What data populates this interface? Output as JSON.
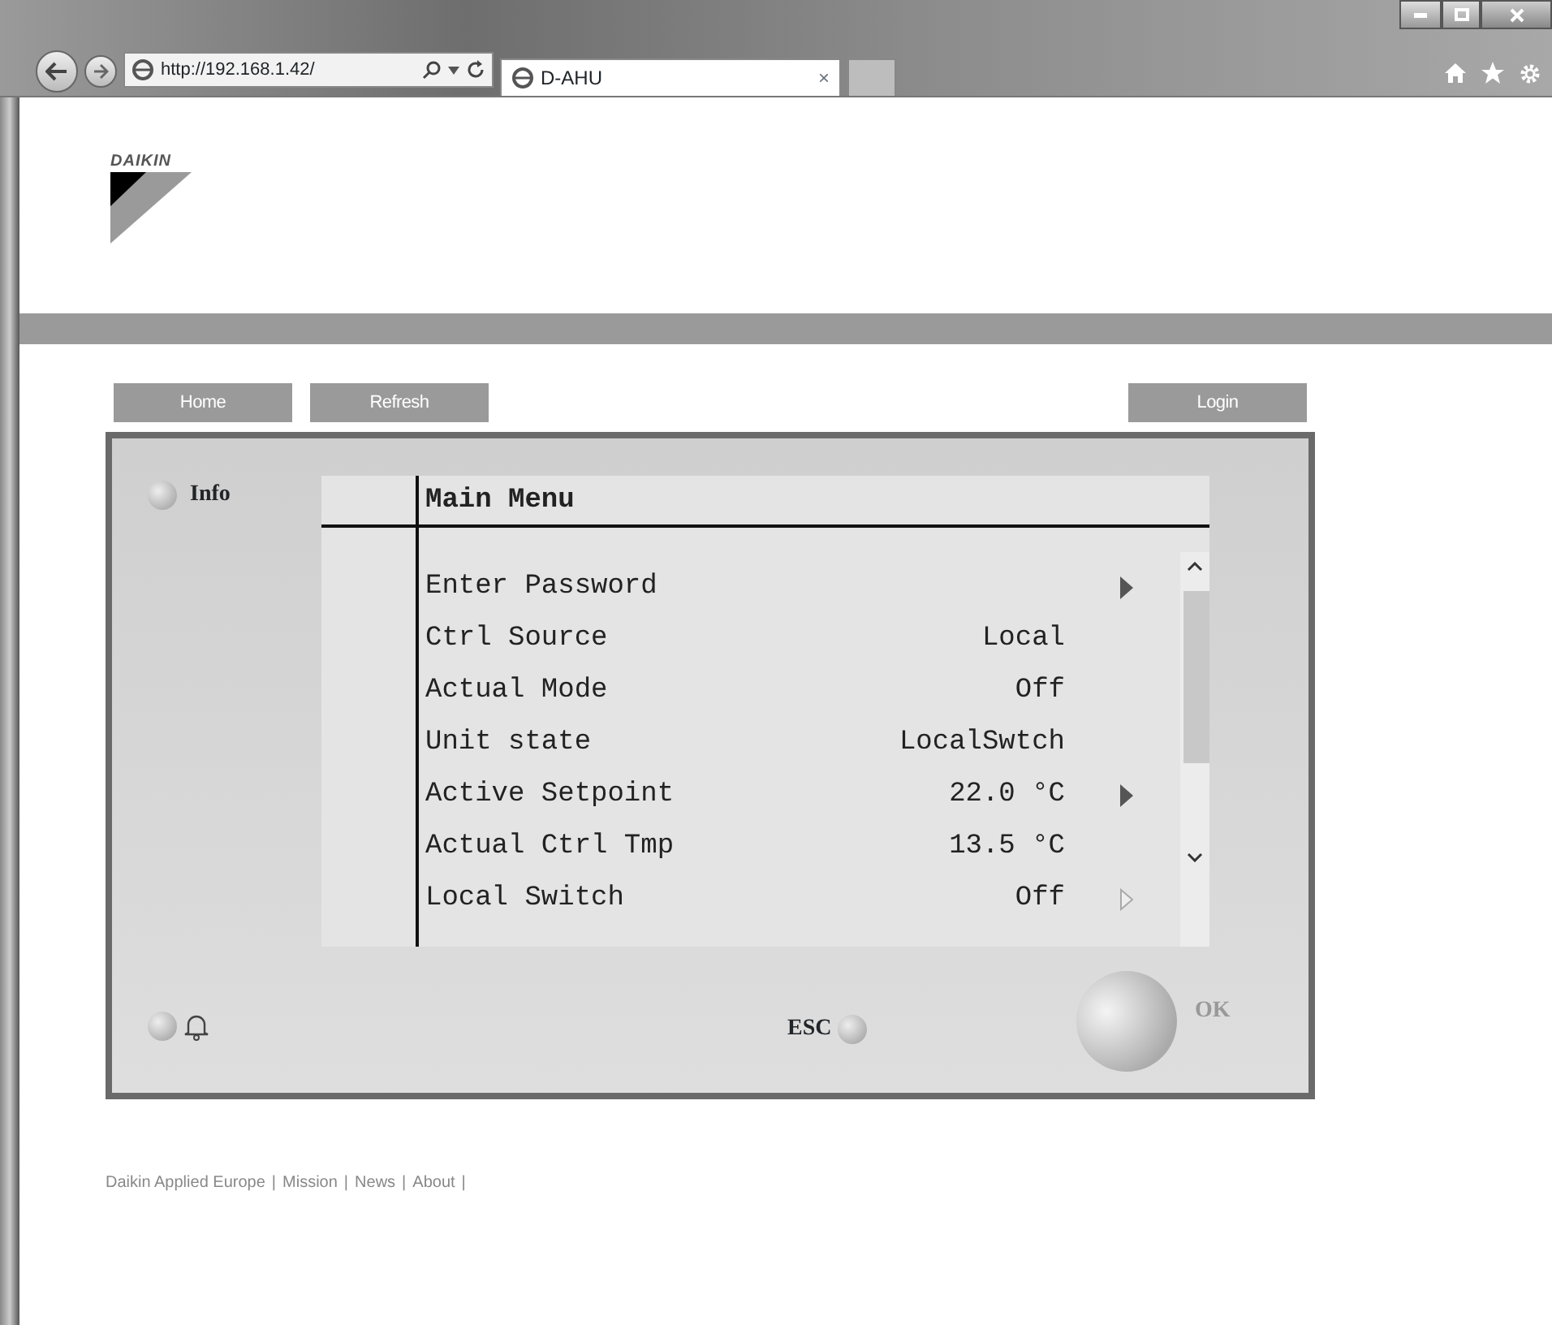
{
  "browser": {
    "address": "http://192.168.1.42/",
    "tab_title": "D-AHU",
    "tab_close": "×"
  },
  "logo": {
    "text": "DAIKIN"
  },
  "nav_buttons": [
    "Home",
    "Refresh"
  ],
  "login_button": "Login",
  "panel": {
    "info_label": "Info",
    "esc_label": "ESC",
    "ok_label": "OK",
    "screen": {
      "title": "Main Menu",
      "rows": [
        {
          "label": "Enter Password",
          "submenu": true,
          "disabled": false
        },
        {
          "label": "Ctrl Source",
          "value": "Local",
          "submenu": false
        },
        {
          "label": "Actual Mode",
          "value": "Off",
          "submenu": false
        },
        {
          "label": "Unit state",
          "value": "LocalSwtch",
          "submenu": false
        },
        {
          "label": "Active Setpoint",
          "value": "22.0 °C",
          "submenu": true,
          "disabled": false
        },
        {
          "label": "Actual Ctrl Tmp",
          "value": "13.5 °C",
          "submenu": false
        },
        {
          "label": "Local Switch",
          "value": "Off",
          "submenu": true,
          "disabled": true
        }
      ]
    }
  },
  "footer": {
    "separator": "|",
    "links": [
      "Daikin Applied Europe",
      "Mission",
      "News",
      "About"
    ]
  }
}
